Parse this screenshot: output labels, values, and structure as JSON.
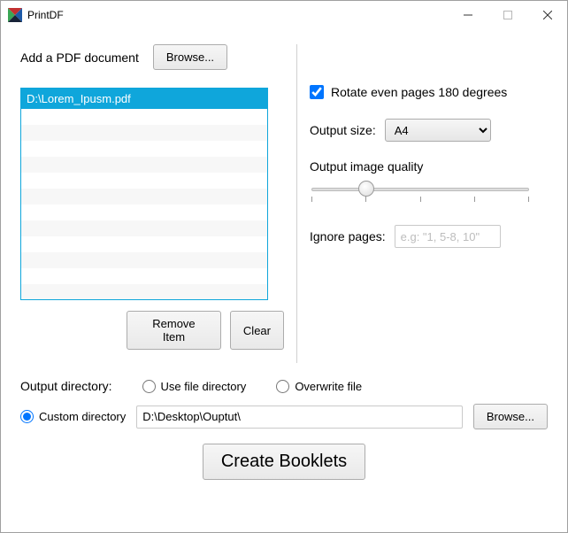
{
  "window": {
    "title": "PrintDF"
  },
  "left": {
    "add_label": "Add a PDF document",
    "browse_label": "Browse...",
    "items": [
      "D:\\Lorem_Ipusm.pdf"
    ],
    "remove_label": "Remove Item",
    "clear_label": "Clear"
  },
  "right": {
    "rotate_label": "Rotate even pages 180 degrees",
    "rotate_checked": true,
    "output_size_label": "Output size:",
    "output_size_value": "A4",
    "quality_label": "Output image quality",
    "ignore_label": "Ignore pages:",
    "ignore_placeholder": "e.g: \"1, 5-8, 10\""
  },
  "output": {
    "dir_label": "Output directory:",
    "opt_usefile": "Use file directory",
    "opt_overwrite": "Overwrite file",
    "opt_custom": "Custom directory",
    "custom_selected": true,
    "custom_path": "D:\\Desktop\\Ouptut\\",
    "browse_label": "Browse...",
    "create_label": "Create Booklets"
  }
}
